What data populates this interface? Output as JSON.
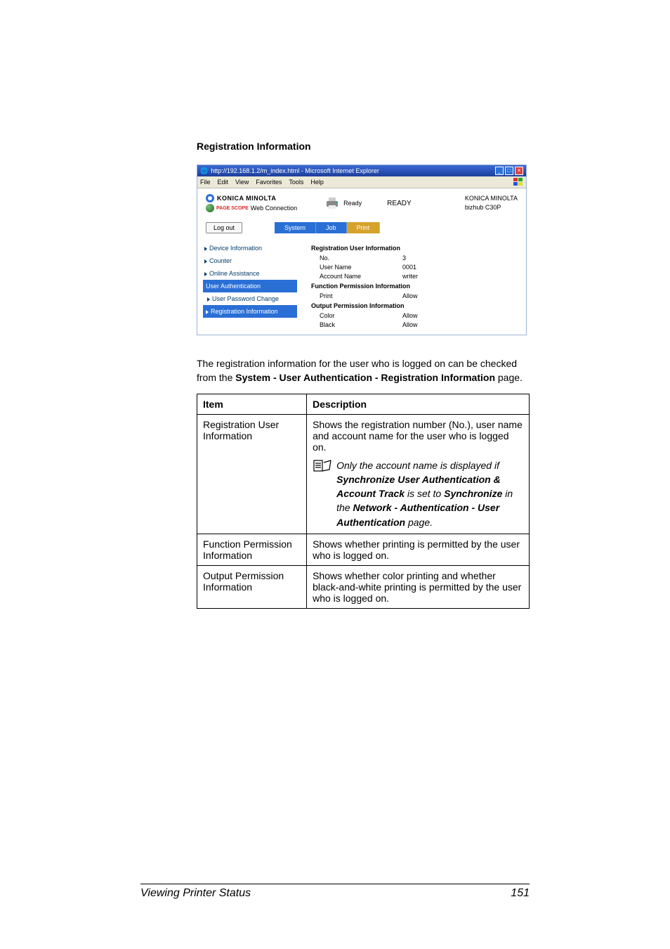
{
  "heading": "Registration Information",
  "browser": {
    "titlebar": "http://192.168.1.2/m_index.html - Microsoft Internet Explorer",
    "menu": {
      "file": "File",
      "edit": "Edit",
      "view": "View",
      "favorites": "Favorites",
      "tools": "Tools",
      "help": "Help"
    },
    "brand": {
      "name": "KONICA MINOLTA",
      "ps": "PAGE SCOPE",
      "wc": "Web Connection"
    },
    "ready": {
      "label": "Ready",
      "big": "READY"
    },
    "device": {
      "maker": "KONICA MINOLTA",
      "model": "bizhub C30P"
    },
    "logout": "Log out",
    "tabs": {
      "system": "System",
      "job": "Job",
      "print": "Print"
    },
    "sidenav": {
      "dev": "Device Information",
      "counter": "Counter",
      "online": "Online Assistance",
      "userauth": "User Authentication",
      "pwchange": "User Password Change",
      "reginfo": "Registration Information"
    },
    "content": {
      "regTitle": "Registration User Information",
      "noLbl": "No.",
      "noVal": "3",
      "userLbl": "User Name",
      "userVal": "0001",
      "acctLbl": "Account Name",
      "acctVal": "writer",
      "fpTitle": "Function Permission Information",
      "printLbl": "Print",
      "printVal": "Allow",
      "opTitle": "Output Permission Information",
      "colorLbl": "Color",
      "colorVal": "Allow",
      "blackLbl": "Black",
      "blackVal": "Allow"
    }
  },
  "para": {
    "l1": "The registration information for the user who is logged on can be checked from the ",
    "bold": "System - User Authentication - Registration Information",
    "l2": " page."
  },
  "table": {
    "h1": "Item",
    "h2": "Description",
    "r1c1": "Registration User Information",
    "r1c2a": "Shows the registration number (No.), user name and account name for the user who is logged on.",
    "r1note1": "Only the account name is displayed if ",
    "r1noteB1": "Synchronize User Authentication & Account Track",
    "r1note2": " is set to ",
    "r1noteB2": "Synchronize",
    "r1note3": " in the ",
    "r1noteB3": "Network - Authentication - User Authentication",
    "r1note4": " page.",
    "r2c1": "Function Permission Information",
    "r2c2": "Shows whether printing is permitted by the user who is logged on.",
    "r3c1": "Output Permission Information",
    "r3c2": "Shows whether color printing and whether black-and-white printing is permitted by the user who is logged on."
  },
  "footer": {
    "left": "Viewing Printer Status",
    "page": "151"
  }
}
